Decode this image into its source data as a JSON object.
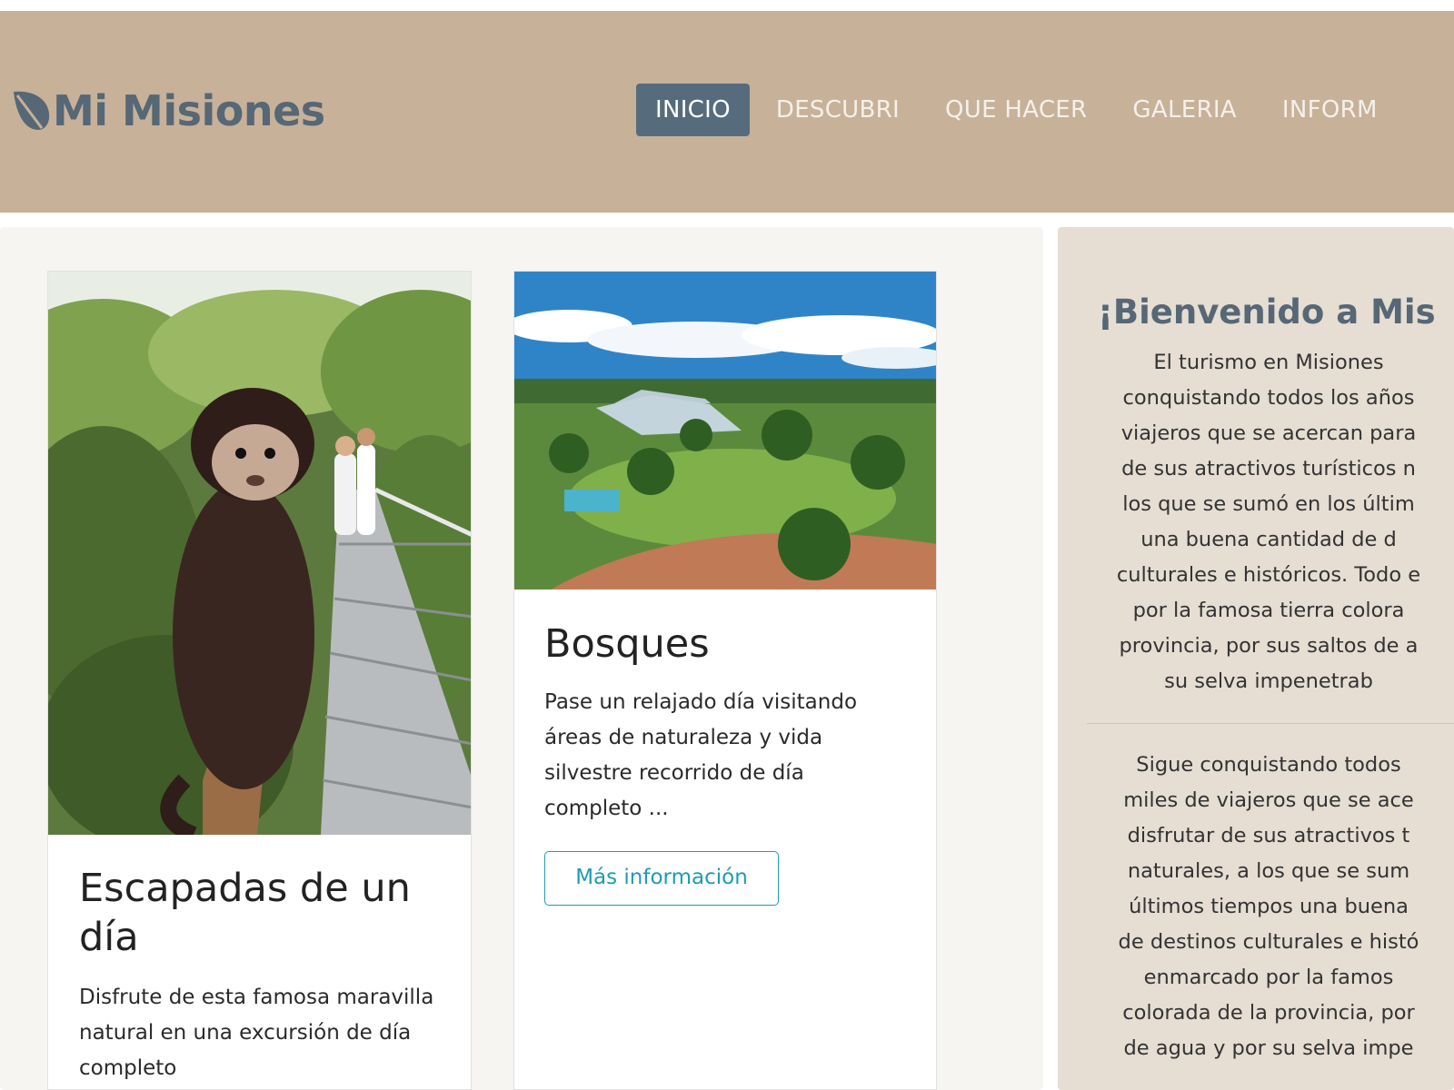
{
  "brand": {
    "name": "Mi Misiones",
    "icon": "leaf-icon"
  },
  "nav": {
    "items": [
      {
        "label": "INICIO",
        "active": true
      },
      {
        "label": "DESCUBRI",
        "active": false
      },
      {
        "label": "QUE HACER",
        "active": false
      },
      {
        "label": "GALERIA",
        "active": false
      },
      {
        "label": "INFORM",
        "active": false
      }
    ]
  },
  "cards": [
    {
      "image": "monkey-on-jungle-walkway-photo",
      "title": "Escapadas de un día",
      "text": "Disfrute de esta famosa maravilla natural en una excursión de día completo"
    },
    {
      "image": "river-and-palm-gardens-photo",
      "title": "Bosques",
      "text": "Pase un relajado día visitando áreas de naturaleza y vida silvestre recorrido de día completo ...",
      "button": "Más información"
    }
  ],
  "sidebar": {
    "title": "¡Bienvenido a Mis",
    "para1_lines": [
      "El turismo en Misiones",
      "conquistando todos los años",
      "viajeros que se acercan para",
      "de sus atractivos turísticos n",
      "los que se sumó en los últim",
      "una buena cantidad de d",
      "culturales e históricos. Todo e",
      "por la famosa tierra colora",
      "provincia, por sus saltos de a",
      "su selva impenetrab"
    ],
    "para2_lines": [
      "Sigue conquistando todos",
      "miles de viajeros que se ace",
      "disfrutar de sus atractivos t",
      "naturales, a los que se sum",
      "últimos tiempos una buena",
      "de destinos culturales e histó",
      "enmarcado por la famos",
      "colorada de la provincia, por",
      "de agua y por su selva impe"
    ]
  },
  "colors": {
    "navbar_bg": "#c7b199",
    "nav_active_bg": "#566c7d",
    "brand": "#566775",
    "button_accent": "#1e9cb0",
    "sidebar_bg": "#e6ddd3"
  }
}
